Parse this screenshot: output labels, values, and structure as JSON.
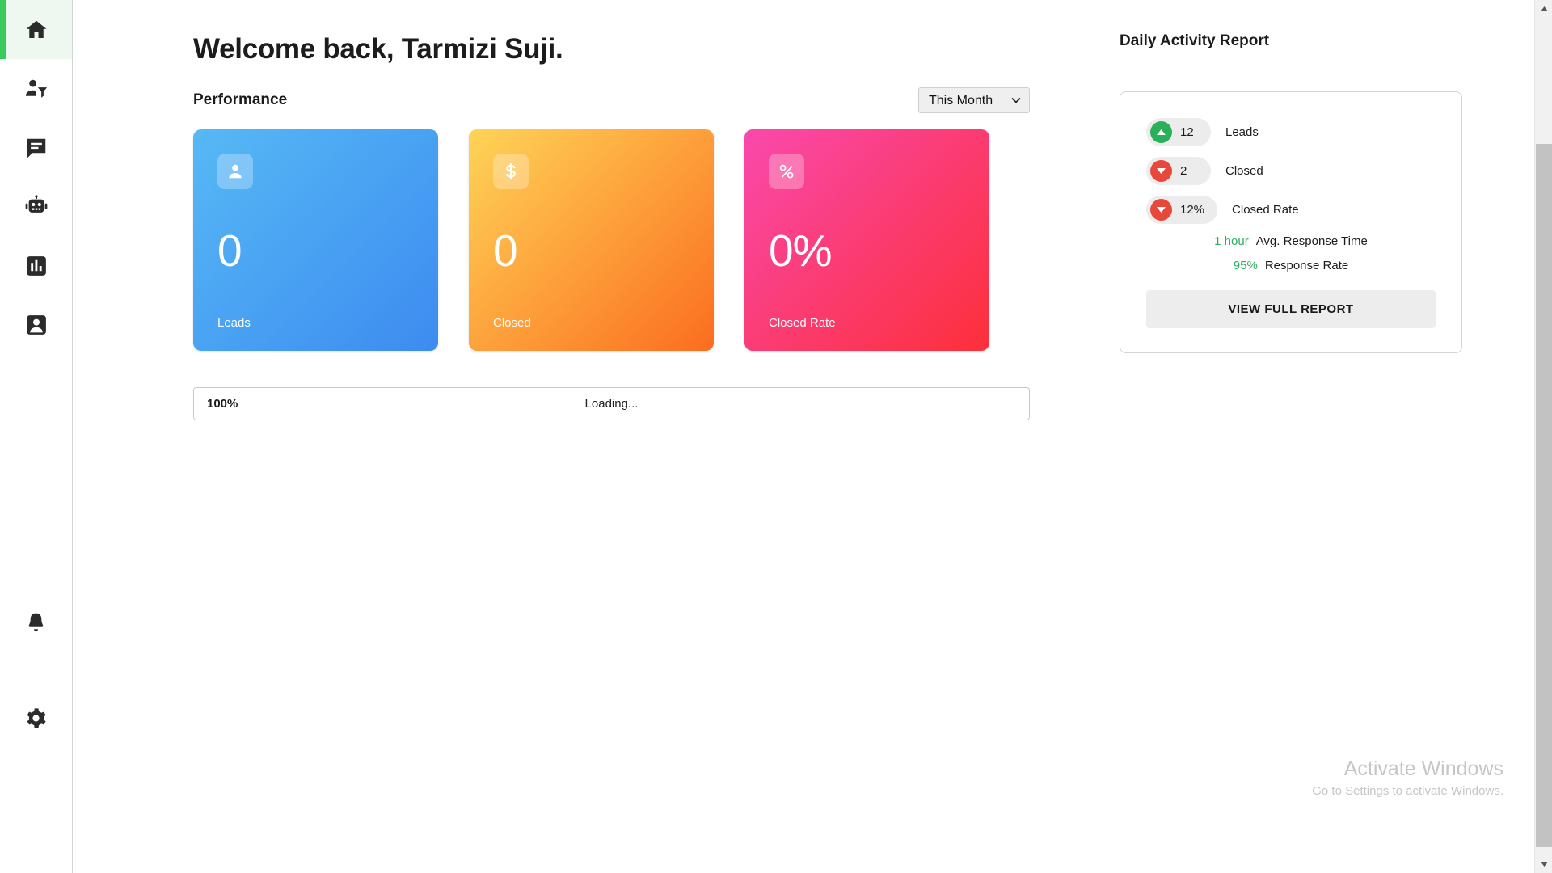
{
  "sidebar": {
    "items": [
      {
        "name": "home",
        "icon": "home-icon",
        "active": true
      },
      {
        "name": "leads",
        "icon": "person-filter-icon",
        "active": false
      },
      {
        "name": "messages",
        "icon": "chat-bubble-icon",
        "active": false
      },
      {
        "name": "bot",
        "icon": "robot-icon",
        "active": false
      },
      {
        "name": "analytics",
        "icon": "bar-chart-icon",
        "active": false
      },
      {
        "name": "contacts",
        "icon": "contact-card-icon",
        "active": false
      }
    ],
    "bottom_items": [
      {
        "name": "notifications",
        "icon": "bell-icon",
        "active": false
      },
      {
        "name": "settings",
        "icon": "gear-icon",
        "active": false
      }
    ],
    "active_indicator_color": "#3ac95b",
    "active_background": "#eef8f0"
  },
  "header": {
    "greeting": "Welcome back, Tarmizi Suji."
  },
  "performance": {
    "section_title": "Performance",
    "period_selected": "This Month",
    "period_options": [
      "This Month"
    ],
    "cards": [
      {
        "value": "0",
        "label": "Leads",
        "icon": "person-icon",
        "accent": "#3d8bf0"
      },
      {
        "value": "0",
        "label": "Closed",
        "icon": "dollar-icon",
        "accent": "#fb6d1f"
      },
      {
        "value": "0%",
        "label": "Closed Rate",
        "icon": "percent-icon",
        "accent": "#fd2f3a"
      }
    ]
  },
  "progress": {
    "percent": "100%",
    "status": "Loading..."
  },
  "daily_activity": {
    "title": "Daily Activity Report",
    "rows": [
      {
        "value": "12",
        "label": "Leads",
        "direction": "up",
        "color": "#2ab05a"
      },
      {
        "value": "2",
        "label": "Closed",
        "direction": "down",
        "color": "#e8483a"
      },
      {
        "value": "12%",
        "label": "Closed Rate",
        "direction": "down",
        "color": "#e8483a"
      }
    ],
    "stats": [
      {
        "value": "1 hour",
        "label": "Avg. Response Time",
        "color": "#2fae5e"
      },
      {
        "value": "95%",
        "label": "Response Rate",
        "color": "#2fae5e"
      }
    ],
    "button_label": "VIEW FULL REPORT"
  },
  "watermark": {
    "title": "Activate Windows",
    "subtitle": "Go to Settings to activate Windows."
  }
}
